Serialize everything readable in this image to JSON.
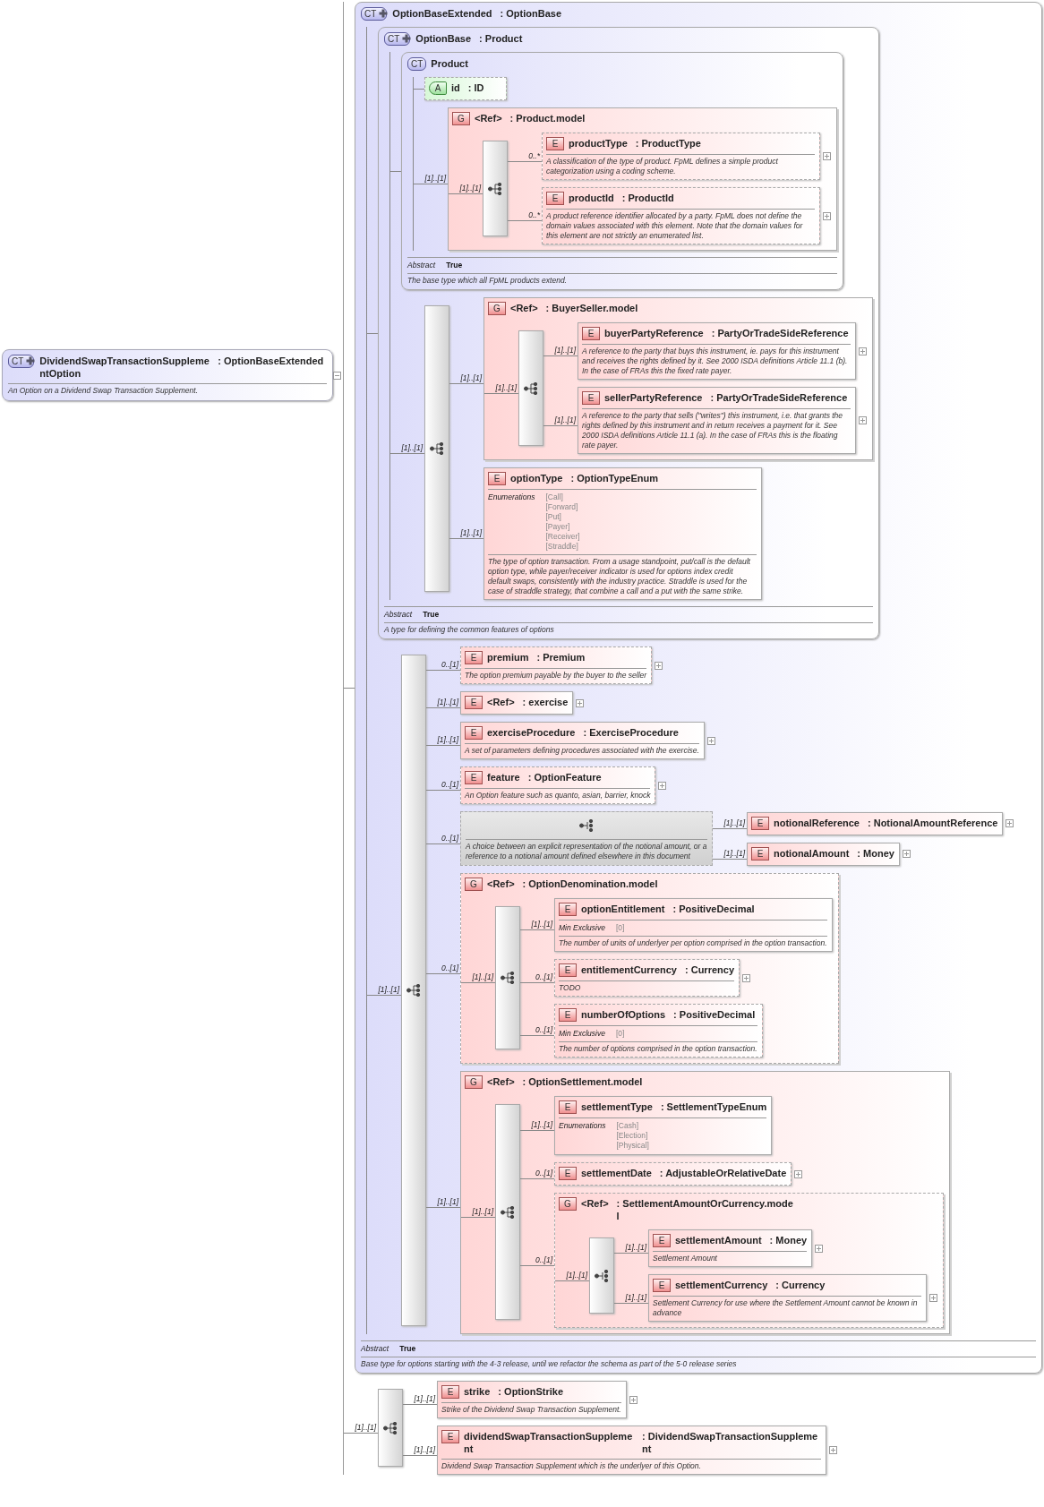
{
  "root": {
    "kind": "complex_type",
    "badge": "CT",
    "derived": true,
    "name": "DividendSwapTransactionSupplementOption",
    "type": ": OptionBaseExtended",
    "collapsed": false,
    "documentation": "An Option on a Dividend Swap Transaction Supplement."
  },
  "structure": [
    {
      "kind": "complex_type",
      "badge": "CT",
      "derived": true,
      "name": "OptionBaseExtended",
      "type": ": OptionBase",
      "children": [
        {
          "kind": "complex_type",
          "badge": "CT",
          "derived": true,
          "name": "OptionBase",
          "type": ": Product",
          "children": [
            {
              "kind": "complex_type",
              "badge": "CT",
              "derived": false,
              "name": "Product",
              "children": [
                {
                  "kind": "attribute",
                  "badge": "A",
                  "name": "id",
                  "type": ": ID",
                  "optional": true
                },
                {
                  "kind": "group",
                  "badge": "G",
                  "name": "<Ref>",
                  "type": ": Product.model",
                  "occurrence": "[1]..[1]",
                  "optional": false,
                  "content": {
                    "kind": "sequence",
                    "occurrence": "[1]..[1]",
                    "children": [
                      {
                        "kind": "element",
                        "badge": "E",
                        "name": "productType",
                        "type": ": ProductType",
                        "occurrence": "0..*",
                        "optional": true,
                        "collapsed": true,
                        "documentation": "A classification of the type of product. FpML defines a simple product categorization using a coding scheme."
                      },
                      {
                        "kind": "element",
                        "badge": "E",
                        "name": "productId",
                        "type": ": ProductId",
                        "occurrence": "0..*",
                        "optional": true,
                        "collapsed": true,
                        "documentation": "A product reference identifier allocated by a party. FpML does not define the domain values associated with this element. Note that the domain values for this element are not strictly an enumerated list."
                      }
                    ]
                  }
                }
              ],
              "properties": [
                {
                  "label": "Abstract",
                  "values": [
                    "True"
                  ]
                }
              ],
              "documentation": "The base type which all FpML products extend."
            },
            {
              "kind": "sequence",
              "occurrence": "[1]..[1]",
              "children": [
                {
                  "kind": "group",
                  "badge": "G",
                  "name": "<Ref>",
                  "type": ": BuyerSeller.model",
                  "occurrence": "[1]..[1]",
                  "optional": false,
                  "content": {
                    "kind": "sequence",
                    "occurrence": "[1]..[1]",
                    "children": [
                      {
                        "kind": "element",
                        "badge": "E",
                        "name": "buyerPartyReference",
                        "type": ": PartyOrTradeSideReference",
                        "occurrence": "[1]..[1]",
                        "optional": false,
                        "collapsed": true,
                        "documentation": "A reference to the party that buys this instrument, ie. pays for this instrument and receives the rights defined by it. See 2000 ISDA definitions Article 11.1 (b). In the case of FRAs this the fixed rate payer."
                      },
                      {
                        "kind": "element",
                        "badge": "E",
                        "name": "sellerPartyReference",
                        "type": ": PartyOrTradeSideReference",
                        "occurrence": "[1]..[1]",
                        "optional": false,
                        "collapsed": true,
                        "documentation": "A reference to the party that sells (\"writes\") this instrument, i.e. that grants the rights defined by this instrument and in return receives a payment for it. See 2000 ISDA definitions Article 11.1 (a). In the case of FRAs this is the floating rate payer."
                      }
                    ]
                  }
                },
                {
                  "kind": "element",
                  "badge": "E",
                  "name": "optionType",
                  "type": ": OptionTypeEnum",
                  "occurrence": "[1]..[1]",
                  "optional": false,
                  "properties": [
                    {
                      "label": "Enumerations",
                      "values": [
                        "[Call]",
                        "[Forward]",
                        "[Put]",
                        "[Payer]",
                        "[Receiver]",
                        "[Straddle]"
                      ]
                    }
                  ],
                  "documentation": "The type of option transaction. From a usage standpoint, put/call is the default option type, while payer/receiver indicator is used for options index credit default swaps, consistently with the industry practice. Straddle is used for the case of straddle strategy, that combine a call and a put with the same strike."
                }
              ]
            }
          ],
          "properties": [
            {
              "label": "Abstract",
              "values": [
                "True"
              ]
            }
          ],
          "documentation": "A type for defining the common features of options"
        },
        {
          "kind": "sequence",
          "occurrence": "[1]..[1]",
          "children": [
            {
              "kind": "element",
              "badge": "E",
              "name": "premium",
              "type": ": Premium",
              "occurrence": "0..[1]",
              "optional": true,
              "collapsed": true,
              "documentation": "The option premium payable by the buyer to the seller"
            },
            {
              "kind": "element",
              "badge": "E",
              "name": "<Ref>",
              "type": ": exercise",
              "occurrence": "[1]..[1]",
              "optional": false,
              "collapsed": true
            },
            {
              "kind": "element",
              "badge": "E",
              "name": "exerciseProcedure",
              "type": ": ExerciseProcedure",
              "occurrence": "[1]..[1]",
              "optional": false,
              "collapsed": true,
              "documentation": "A set of parameters defining procedures associated with the exercise."
            },
            {
              "kind": "element",
              "badge": "E",
              "name": "feature",
              "type": ": OptionFeature",
              "occurrence": "0..[1]",
              "optional": true,
              "collapsed": true,
              "documentation": "An Option feature such as quanto, asian, barrier, knock"
            },
            {
              "kind": "choice",
              "occurrence": "0..[1]",
              "optional": true,
              "documentation": "A choice between an explicit representation of the notional amount, or a reference to a notional amount defined elsewhere in this document",
              "children": [
                {
                  "kind": "element",
                  "badge": "E",
                  "name": "notionalReference",
                  "type": ": NotionalAmountReference",
                  "occurrence": "[1]..[1]",
                  "optional": false,
                  "collapsed": true
                },
                {
                  "kind": "element",
                  "badge": "E",
                  "name": "notionalAmount",
                  "type": ": Money",
                  "occurrence": "[1]..[1]",
                  "optional": false,
                  "collapsed": true
                }
              ]
            },
            {
              "kind": "group",
              "badge": "G",
              "name": "<Ref>",
              "type": ": OptionDenomination.model",
              "occurrence": "0..[1]",
              "optional": true,
              "content": {
                "kind": "sequence",
                "occurrence": "[1]..[1]",
                "children": [
                  {
                    "kind": "element",
                    "badge": "E",
                    "name": "optionEntitlement",
                    "type": ": PositiveDecimal",
                    "occurrence": "[1]..[1]",
                    "optional": false,
                    "properties": [
                      {
                        "label": "Min Exclusive",
                        "values": [
                          "[0]"
                        ]
                      }
                    ],
                    "documentation": "The number of units of underlyer per option comprised in the option transaction."
                  },
                  {
                    "kind": "element",
                    "badge": "E",
                    "name": "entitlementCurrency",
                    "type": ": Currency",
                    "occurrence": "0..[1]",
                    "optional": true,
                    "collapsed": true,
                    "documentation": "TODO"
                  },
                  {
                    "kind": "element",
                    "badge": "E",
                    "name": "numberOfOptions",
                    "type": ": PositiveDecimal",
                    "occurrence": "0..[1]",
                    "optional": true,
                    "properties": [
                      {
                        "label": "Min Exclusive",
                        "values": [
                          "[0]"
                        ]
                      }
                    ],
                    "documentation": "The number of options comprised in the option transaction."
                  }
                ]
              }
            },
            {
              "kind": "group",
              "badge": "G",
              "name": "<Ref>",
              "type": ": OptionSettlement.model",
              "occurrence": "[1]..[1]",
              "optional": false,
              "content": {
                "kind": "sequence",
                "occurrence": "[1]..[1]",
                "children": [
                  {
                    "kind": "element",
                    "badge": "E",
                    "name": "settlementType",
                    "type": ": SettlementTypeEnum",
                    "occurrence": "[1]..[1]",
                    "optional": false,
                    "properties": [
                      {
                        "label": "Enumerations",
                        "values": [
                          "[Cash]",
                          "[Election]",
                          "[Physical]"
                        ]
                      }
                    ]
                  },
                  {
                    "kind": "element",
                    "badge": "E",
                    "name": "settlementDate",
                    "type": ": AdjustableOrRelativeDate",
                    "occurrence": "0..[1]",
                    "optional": true,
                    "collapsed": true
                  },
                  {
                    "kind": "group",
                    "badge": "G",
                    "name": "<Ref>",
                    "type": ": SettlementAmountOrCurrency.model",
                    "occurrence": "0..[1]",
                    "optional": true,
                    "content": {
                      "kind": "choice",
                      "occurrence": "[1]..[1]",
                      "children": [
                        {
                          "kind": "element",
                          "badge": "E",
                          "name": "settlementAmount",
                          "type": ": Money",
                          "occurrence": "[1]..[1]",
                          "optional": false,
                          "collapsed": true,
                          "documentation": "Settlement Amount"
                        },
                        {
                          "kind": "element",
                          "badge": "E",
                          "name": "settlementCurrency",
                          "type": ": Currency",
                          "occurrence": "[1]..[1]",
                          "optional": false,
                          "collapsed": true,
                          "documentation": "Settlement Currency for use where the Settlement Amount cannot be known in advance"
                        }
                      ]
                    }
                  }
                ]
              }
            }
          ]
        }
      ],
      "properties": [
        {
          "label": "Abstract",
          "values": [
            "True"
          ]
        }
      ],
      "documentation": "Base type for options starting with the 4-3 release, until we refactor the schema as part of the 5-0 release series"
    },
    {
      "kind": "sequence",
      "occurrence": "[1]..[1]",
      "children": [
        {
          "kind": "element",
          "badge": "E",
          "name": "strike",
          "type": ": OptionStrike",
          "occurrence": "[1]..[1]",
          "optional": false,
          "collapsed": true,
          "documentation": "Strike of the Dividend Swap Transaction Supplement."
        },
        {
          "kind": "element",
          "badge": "E",
          "name": "dividendSwapTransactionSupplement",
          "type": ": DividendSwapTransactionSupplement",
          "occurrence": "[1]..[1]",
          "optional": false,
          "collapsed": true,
          "documentation": "Dividend Swap Transaction Supplement which is the underlyer of this Option."
        }
      ]
    }
  ]
}
